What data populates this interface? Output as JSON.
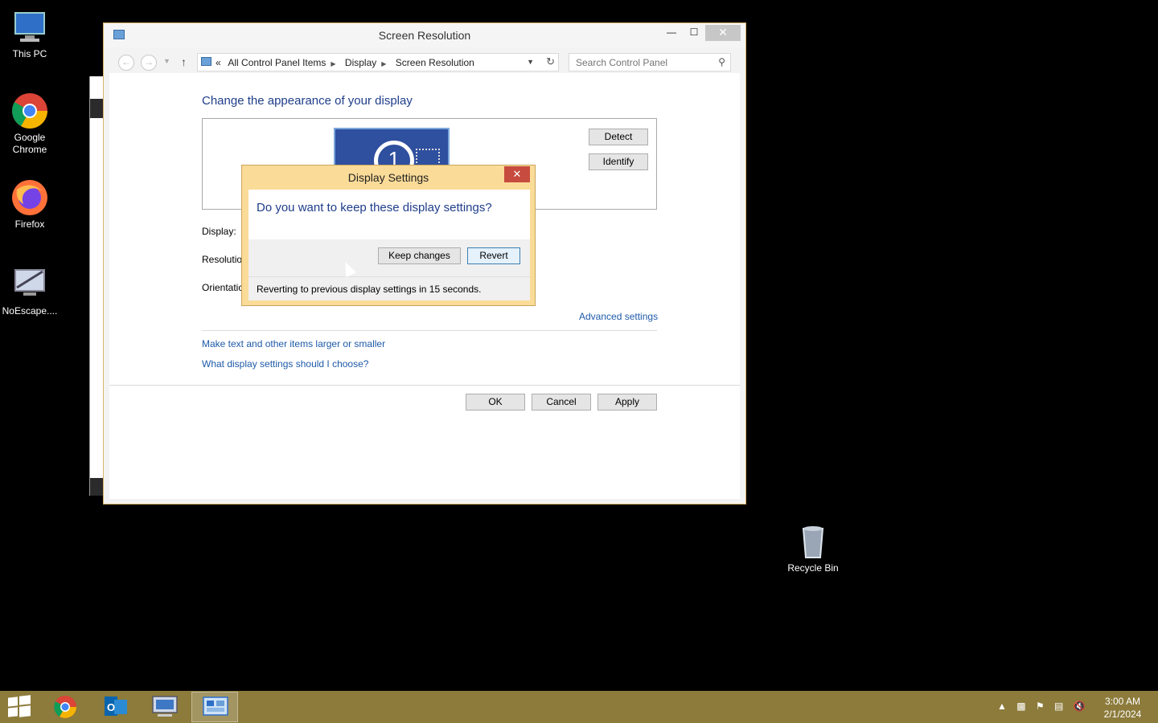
{
  "desktop": {
    "icons": [
      {
        "label": "This PC"
      },
      {
        "label": "Google Chrome"
      },
      {
        "label": "Firefox"
      },
      {
        "label": "NoEscape...."
      },
      {
        "label": "Recycle Bin"
      }
    ]
  },
  "window": {
    "title": "Screen Resolution",
    "minimize_icon": "minimize-icon",
    "maximize_icon": "maximize-icon",
    "close_icon": "close-icon",
    "breadcrumb": {
      "prefix": "«",
      "items": [
        "All Control Panel Items",
        "Display",
        "Screen Resolution"
      ]
    },
    "search_placeholder": "Search Control Panel",
    "heading": "Change the appearance of your display",
    "monitor_number": "1",
    "detect_label": "Detect",
    "identify_label": "Identify",
    "display_label": "Display:",
    "resolution_label": "Resolutio",
    "orientation_label": "Orientatic",
    "advanced_link": "Advanced settings",
    "links": [
      "Make text and other items larger or smaller",
      "What display settings should I choose?"
    ],
    "ok_label": "OK",
    "cancel_label": "Cancel",
    "apply_label": "Apply"
  },
  "dialog": {
    "title": "Display Settings",
    "question": "Do you want to keep these display settings?",
    "keep_label": "Keep changes",
    "revert_label": "Revert",
    "countdown_text": "Reverting to previous display settings in 15 seconds."
  },
  "taskbar": {
    "apps": [
      "chrome-icon",
      "outlook-icon",
      "remote-desktop-icon",
      "control-panel-icon"
    ],
    "clock_time": "3:00 AM",
    "clock_date": "2/1/2024"
  },
  "colors": {
    "taskbar": "#8c7b3b",
    "dialog_frame": "#fadb98",
    "link": "#1e5aa8",
    "heading": "#1e3d8a"
  }
}
